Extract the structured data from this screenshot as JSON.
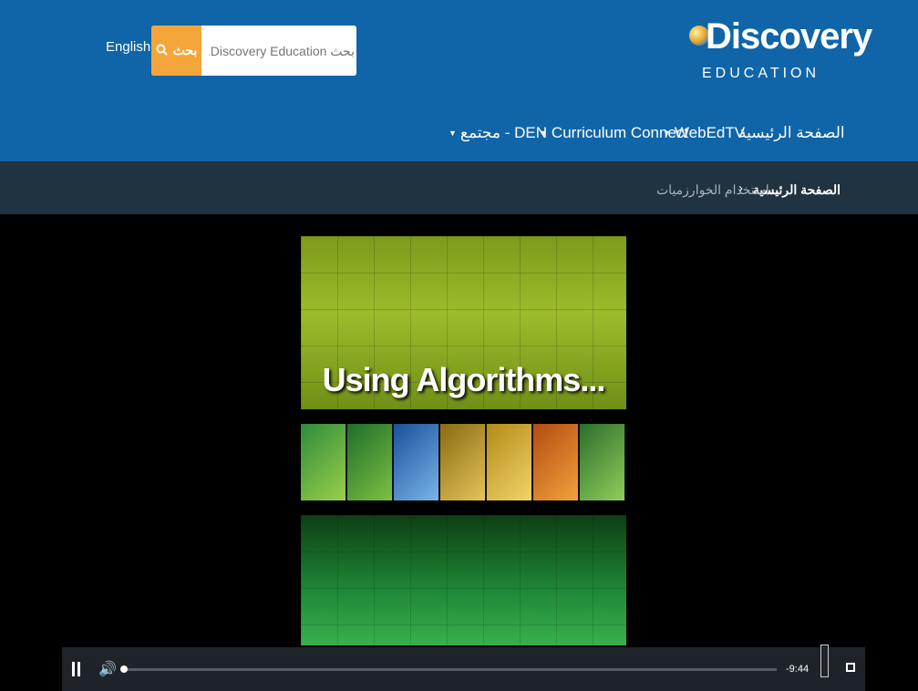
{
  "header": {
    "language_link": "English",
    "search": {
      "button_label": "بحث",
      "placeholder": "بحث Discovery Education..."
    },
    "logo": {
      "main": "Discovery",
      "sub": "EDUCATION"
    },
    "nav": [
      {
        "label": "الصفحة الرئيسية"
      },
      {
        "label": "WebEdTV"
      },
      {
        "label": "Curriculum Connect"
      },
      {
        "label": "مجتمع - DEN"
      }
    ]
  },
  "breadcrumb": {
    "home": "الصفحة الرئيسية",
    "separator": "›",
    "current": "استخدام الخوارزميات"
  },
  "video": {
    "title_text": "Using Algorithms...",
    "time_remaining": "-9:44",
    "progress_fraction": 0.0
  },
  "colors": {
    "header_bg": "#0f65a8",
    "breadcrumb_bg": "#1f3340",
    "search_button": "#f4a63a",
    "controls_bg": "#1d2329"
  }
}
